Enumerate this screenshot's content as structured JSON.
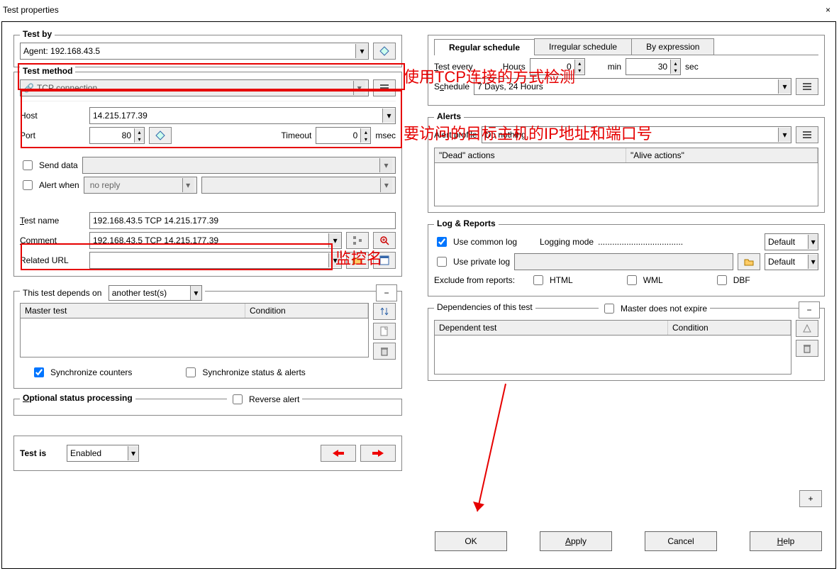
{
  "window": {
    "title": "Test properties"
  },
  "left": {
    "test_by_label": "Test by",
    "agent": "Agent: 192.168.43.5",
    "test_method_label": "Test method",
    "test_method": "TCP connection",
    "host_label": "Host",
    "host": "14.215.177.39",
    "port_label": "Port",
    "port": "80",
    "timeout_label": "Timeout",
    "timeout": "0",
    "msec": "msec",
    "send_data_label": "Send data",
    "alert_when_label": "Alert when",
    "alert_when_value": "no reply",
    "test_name_label": "Test name",
    "test_name": "192.168.43.5 TCP 14.215.177.39",
    "comment_label": "Comment",
    "comment": "192.168.43.5 TCP 14.215.177.39",
    "related_url_label": "Related URL",
    "depends_title": "This test depends on",
    "depends_mode": "another test(s)",
    "master_hdr": "Master test",
    "condition_hdr": "Condition",
    "sync_counters": "Synchronize counters",
    "sync_status": "Synchronize status & alerts",
    "optional_title": "Optional status processing",
    "reverse_alert": "Reverse alert",
    "test_is_label": "Test is",
    "test_is_value": "Enabled"
  },
  "right": {
    "tab1": "Regular schedule",
    "tab2": "Irregular schedule",
    "tab3": "By expression",
    "test_every_label": "Test every",
    "hours_label": "Hours",
    "hours_value": "0",
    "min_label": "min",
    "min_value": "0",
    "sec_label": "sec",
    "sec_value": "30",
    "schedule_label": "Schedule",
    "schedule_value": "7 Days, 24 Hours",
    "alerts_title": "Alerts",
    "alert_profile_label": "Alert profile",
    "alert_profile_value": "Do nothing",
    "dead_hdr": "\"Dead\" actions",
    "alive_hdr": "\"Alive actions\"",
    "log_title": "Log & Reports",
    "use_common": "Use common log",
    "use_private": "Use private log",
    "logging_mode": "Logging mode",
    "logging_dots": "....................................",
    "default": "Default",
    "exclude_label": "Exclude from reports:",
    "html": "HTML",
    "wml": "WML",
    "dbf": "DBF",
    "deps_title": "Dependencies of this test",
    "master_not_expire": "Master does not expire",
    "dep_hdr": "Dependent test",
    "cond_hdr": "Condition",
    "ok": "OK",
    "apply": "Apply",
    "cancel": "Cancel",
    "help": "Help"
  },
  "annotations": {
    "a1": "使用TCP连接的方式检测",
    "a2": "要访问的目标主机的IP地址和端口号",
    "a3": "监控名"
  }
}
